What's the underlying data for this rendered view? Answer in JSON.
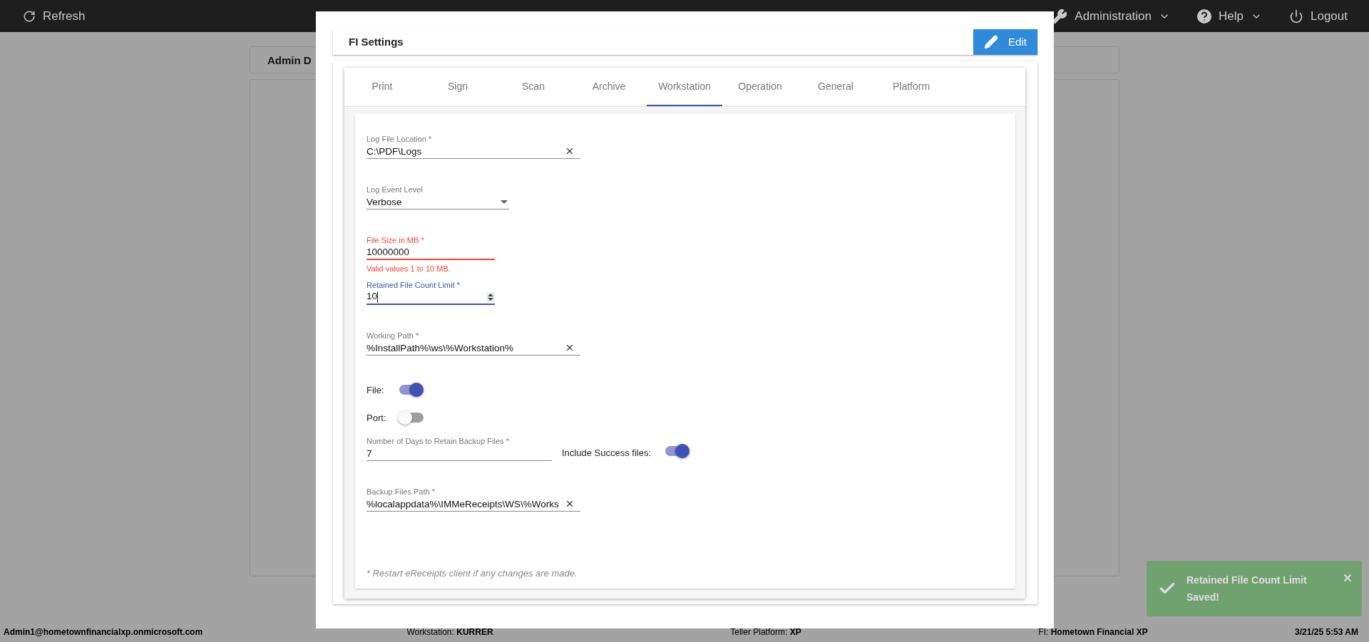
{
  "top_bar": {
    "refresh": "Refresh",
    "menus": [
      {
        "label": "Administration",
        "kind": "admin"
      },
      {
        "label": "Help",
        "kind": "help"
      },
      {
        "label": "Logout",
        "kind": "logout"
      }
    ]
  },
  "background_tab": "Admin D",
  "dialog": {
    "title": "FI Settings",
    "edit_button": "Edit",
    "tabs": [
      {
        "label": "Print",
        "selected": false
      },
      {
        "label": "Sign",
        "selected": false
      },
      {
        "label": "Scan",
        "selected": false
      },
      {
        "label": "Archive",
        "selected": false
      },
      {
        "label": "Workstation",
        "selected": true
      },
      {
        "label": "Operation",
        "selected": false
      },
      {
        "label": "General",
        "selected": false
      },
      {
        "label": "Platform",
        "selected": false
      }
    ],
    "fields": [
      {
        "kind": "text",
        "label": "Log File Location *",
        "value": "C:\\PDF\\Logs",
        "clearable": true
      },
      {
        "kind": "select",
        "label": "Log Event Level",
        "value": "Verbose"
      },
      {
        "kind": "number",
        "label": "File Size in MB *",
        "value": "10000000",
        "error": "Valid values 1 to 10 MB.",
        "focused": false
      },
      {
        "kind": "number",
        "label": "Retained File Count Limit *",
        "value": "10",
        "focused": true
      },
      {
        "kind": "text",
        "label": "Working Path *",
        "value": "%InstallPath%\\ws\\%Workstation%",
        "clearable": true
      },
      {
        "kind": "toggle",
        "label": "File:",
        "on": true
      },
      {
        "kind": "toggle",
        "label": "Port:",
        "on": false
      },
      {
        "kind": "text_toggle",
        "label": "Number of Days to Retain Backup Files *",
        "value": "7",
        "toggle_label": "Include Success files:",
        "on": true
      },
      {
        "kind": "text",
        "label": "Backup Files Path *",
        "value": "%localappdata%\\IMMeReceipts\\WS\\%Works",
        "clearable": true
      }
    ],
    "note": "* Restart eReceipts client if any changes are made."
  },
  "toast": {
    "message": "Retained File Count Limit Saved!"
  },
  "status_bar": {
    "user": "Admin1@hometownfinancialxp.onmicrosoft.com",
    "items": [
      {
        "label": "Workstation:",
        "value": "KURRER"
      },
      {
        "label": "Teller Platform:",
        "value": "XP"
      },
      {
        "label": "FI:",
        "value": "Hometown Financial XP"
      }
    ],
    "datetime": "3/21/25 5:53 AM"
  }
}
